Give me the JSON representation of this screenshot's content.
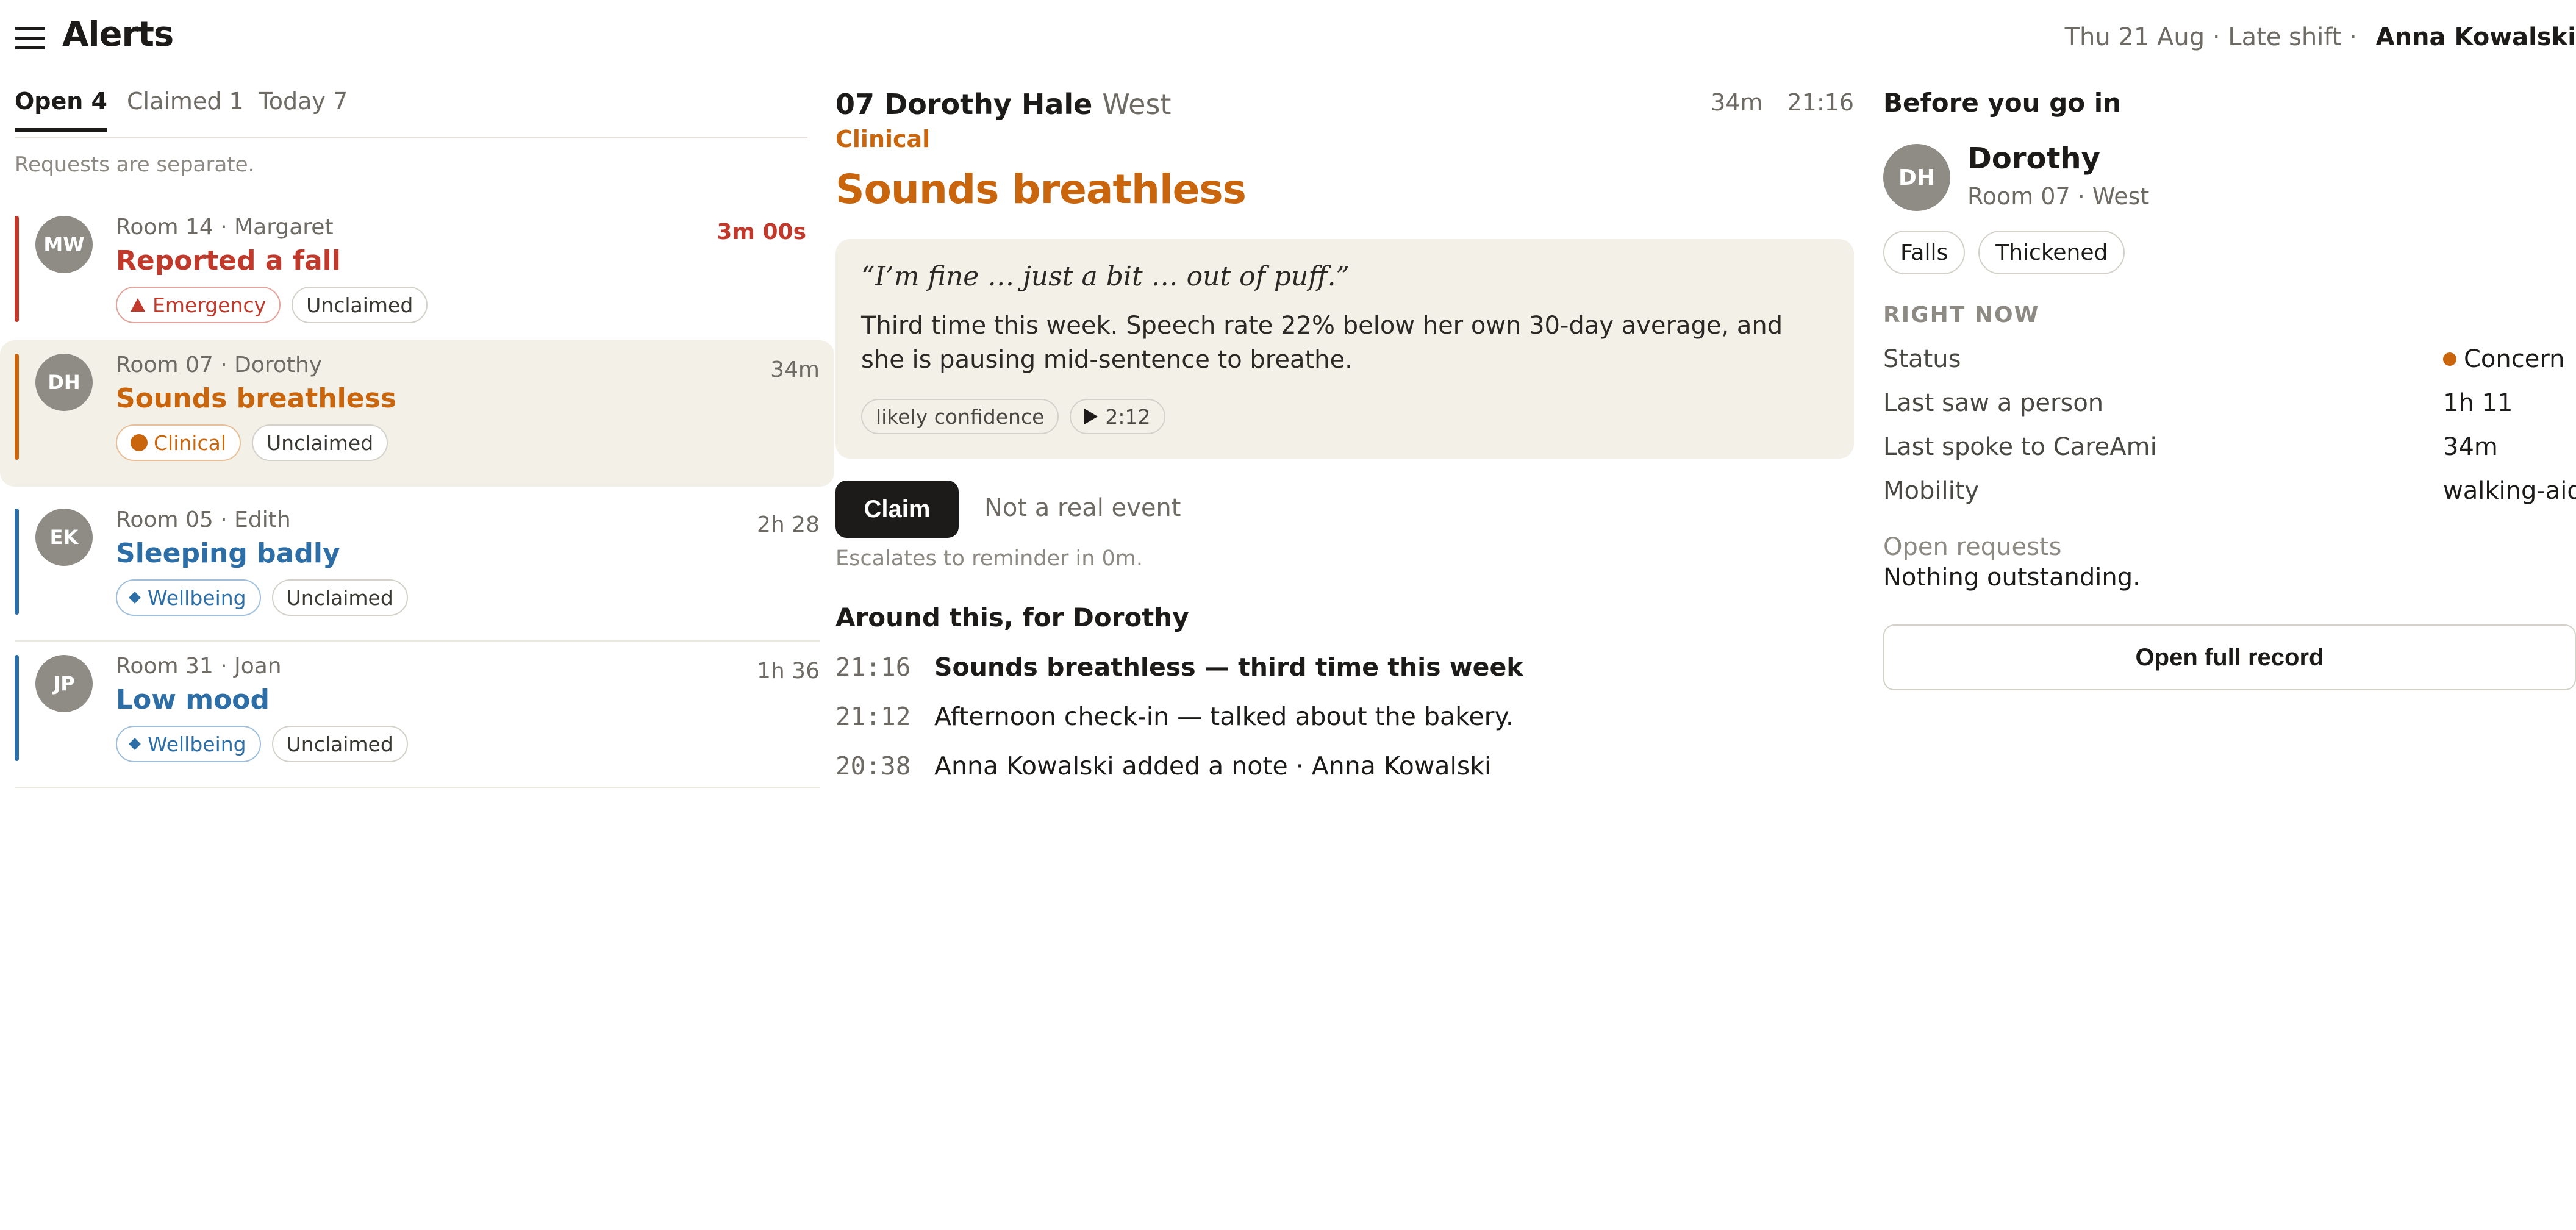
{
  "header": {
    "title": "Alerts",
    "shift_info": "Thu 21 Aug · Late shift ·",
    "user": "Anna Kowalski"
  },
  "tabs": [
    {
      "label": "Open 4",
      "active": true
    },
    {
      "label": "Claimed 1",
      "active": false
    },
    {
      "label": "Today 7",
      "active": false
    }
  ],
  "list_note": "Requests are separate.",
  "alerts": [
    {
      "initials": "MW",
      "room": "Room 14 · Margaret",
      "headline": "Reported a fall",
      "time": "3m 00s",
      "category": "Emergency",
      "status": "Unclaimed",
      "color": "#c0392b"
    },
    {
      "initials": "DH",
      "room": "Room 07 · Dorothy",
      "headline": "Sounds breathless",
      "time": "34m",
      "category": "Clinical",
      "status": "Unclaimed",
      "color": "#c9650d"
    },
    {
      "initials": "EK",
      "room": "Room 05 · Edith",
      "headline": "Sleeping badly",
      "time": "2h 28",
      "category": "Wellbeing",
      "status": "Unclaimed",
      "color": "#2e6ea6"
    },
    {
      "initials": "JP",
      "room": "Room 31 · Joan",
      "headline": "Low mood",
      "time": "1h 36",
      "category": "Wellbeing",
      "status": "Unclaimed",
      "color": "#2e6ea6"
    }
  ],
  "detail": {
    "room_name": "07 Dorothy Hale",
    "wing": "West",
    "elapsed": "34m",
    "clock": "21:16",
    "category": "Clinical",
    "title": "Sounds breathless",
    "quote": "“I’m fine … just a bit … out of puff.”",
    "summary": "Third time this week. Speech rate 22% below her own 30-day average, and she is pausing mid-sentence to breathe.",
    "confidence_chip": "likely confidence",
    "audio_chip": "2:12",
    "claim_label": "Claim",
    "dismiss_label": "Not a real event",
    "escalation_note": "Escalates to reminder in 0m.",
    "around_title": "Around this, for Dorothy",
    "timeline": [
      {
        "time": "21:16",
        "text": "Sounds breathless — third time this week"
      },
      {
        "time": "21:12",
        "text": "Afternoon check-in — talked about the bakery."
      },
      {
        "time": "20:38",
        "text": "Anna Kowalski added a note · Anna Kowalski"
      }
    ]
  },
  "resident": {
    "panel_title": "Before you go in",
    "initials": "DH",
    "name": "Dorothy",
    "room": "Room 07 · West",
    "tags": [
      "Falls",
      "Thickened"
    ],
    "section_title": "RIGHT NOW",
    "facts": [
      {
        "label": "Status",
        "value": "Concern"
      },
      {
        "label": "Last saw a person",
        "value": "1h 11"
      },
      {
        "label": "Last spoke to CareAmi",
        "value": "34m"
      },
      {
        "label": "Mobility",
        "value": "walking-aid"
      }
    ],
    "requests_label": "Open requests",
    "requests_value": "Nothing outstanding.",
    "open_record_label": "Open full record"
  }
}
